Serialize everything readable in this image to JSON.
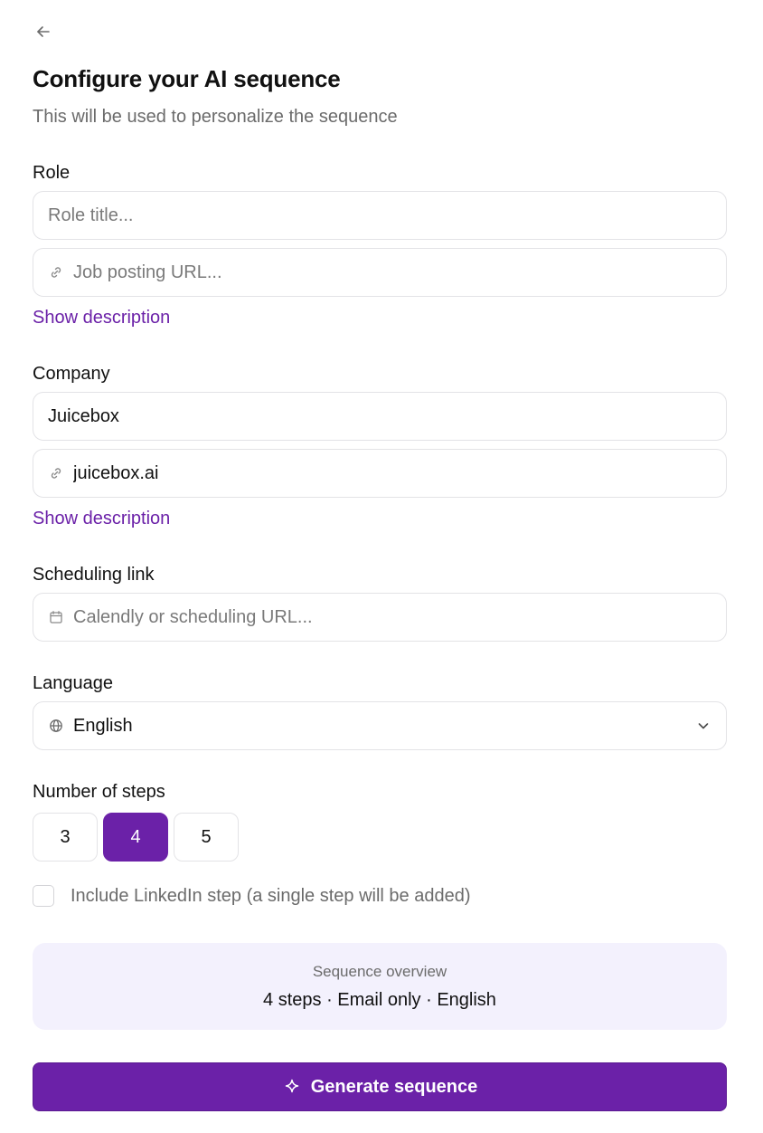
{
  "header": {
    "title": "Configure your AI sequence",
    "subtitle": "This will be used to personalize the sequence"
  },
  "role": {
    "label": "Role",
    "title_field": {
      "value": "",
      "placeholder": "Role title..."
    },
    "url_field": {
      "value": "",
      "placeholder": "Job posting URL..."
    },
    "show_description": "Show description"
  },
  "company": {
    "label": "Company",
    "name_field": {
      "value": "Juicebox",
      "placeholder": ""
    },
    "url_field": {
      "value": "juicebox.ai",
      "placeholder": ""
    },
    "show_description": "Show description"
  },
  "scheduling": {
    "label": "Scheduling link",
    "field": {
      "value": "",
      "placeholder": "Calendly or scheduling URL..."
    }
  },
  "language": {
    "label": "Language",
    "selected": "English"
  },
  "steps": {
    "label": "Number of steps",
    "options": [
      "3",
      "4",
      "5"
    ],
    "selected": "4"
  },
  "linkedin": {
    "label": "Include LinkedIn step (a single step will be added)",
    "checked": false
  },
  "overview": {
    "title": "Sequence overview",
    "summary": "4 steps · Email only · English"
  },
  "generate_button": {
    "label": "Generate sequence"
  },
  "colors": {
    "accent": "#6b21a8",
    "overview_bg": "#f3f1fd",
    "border": "#e3e3e6",
    "muted_text": "#6b6b6b"
  },
  "icons": {
    "back": "arrow-left-icon",
    "link": "link-icon",
    "calendar": "calendar-icon",
    "globe": "globe-icon",
    "chevron": "chevron-down-icon",
    "sparkle": "sparkle-icon"
  }
}
